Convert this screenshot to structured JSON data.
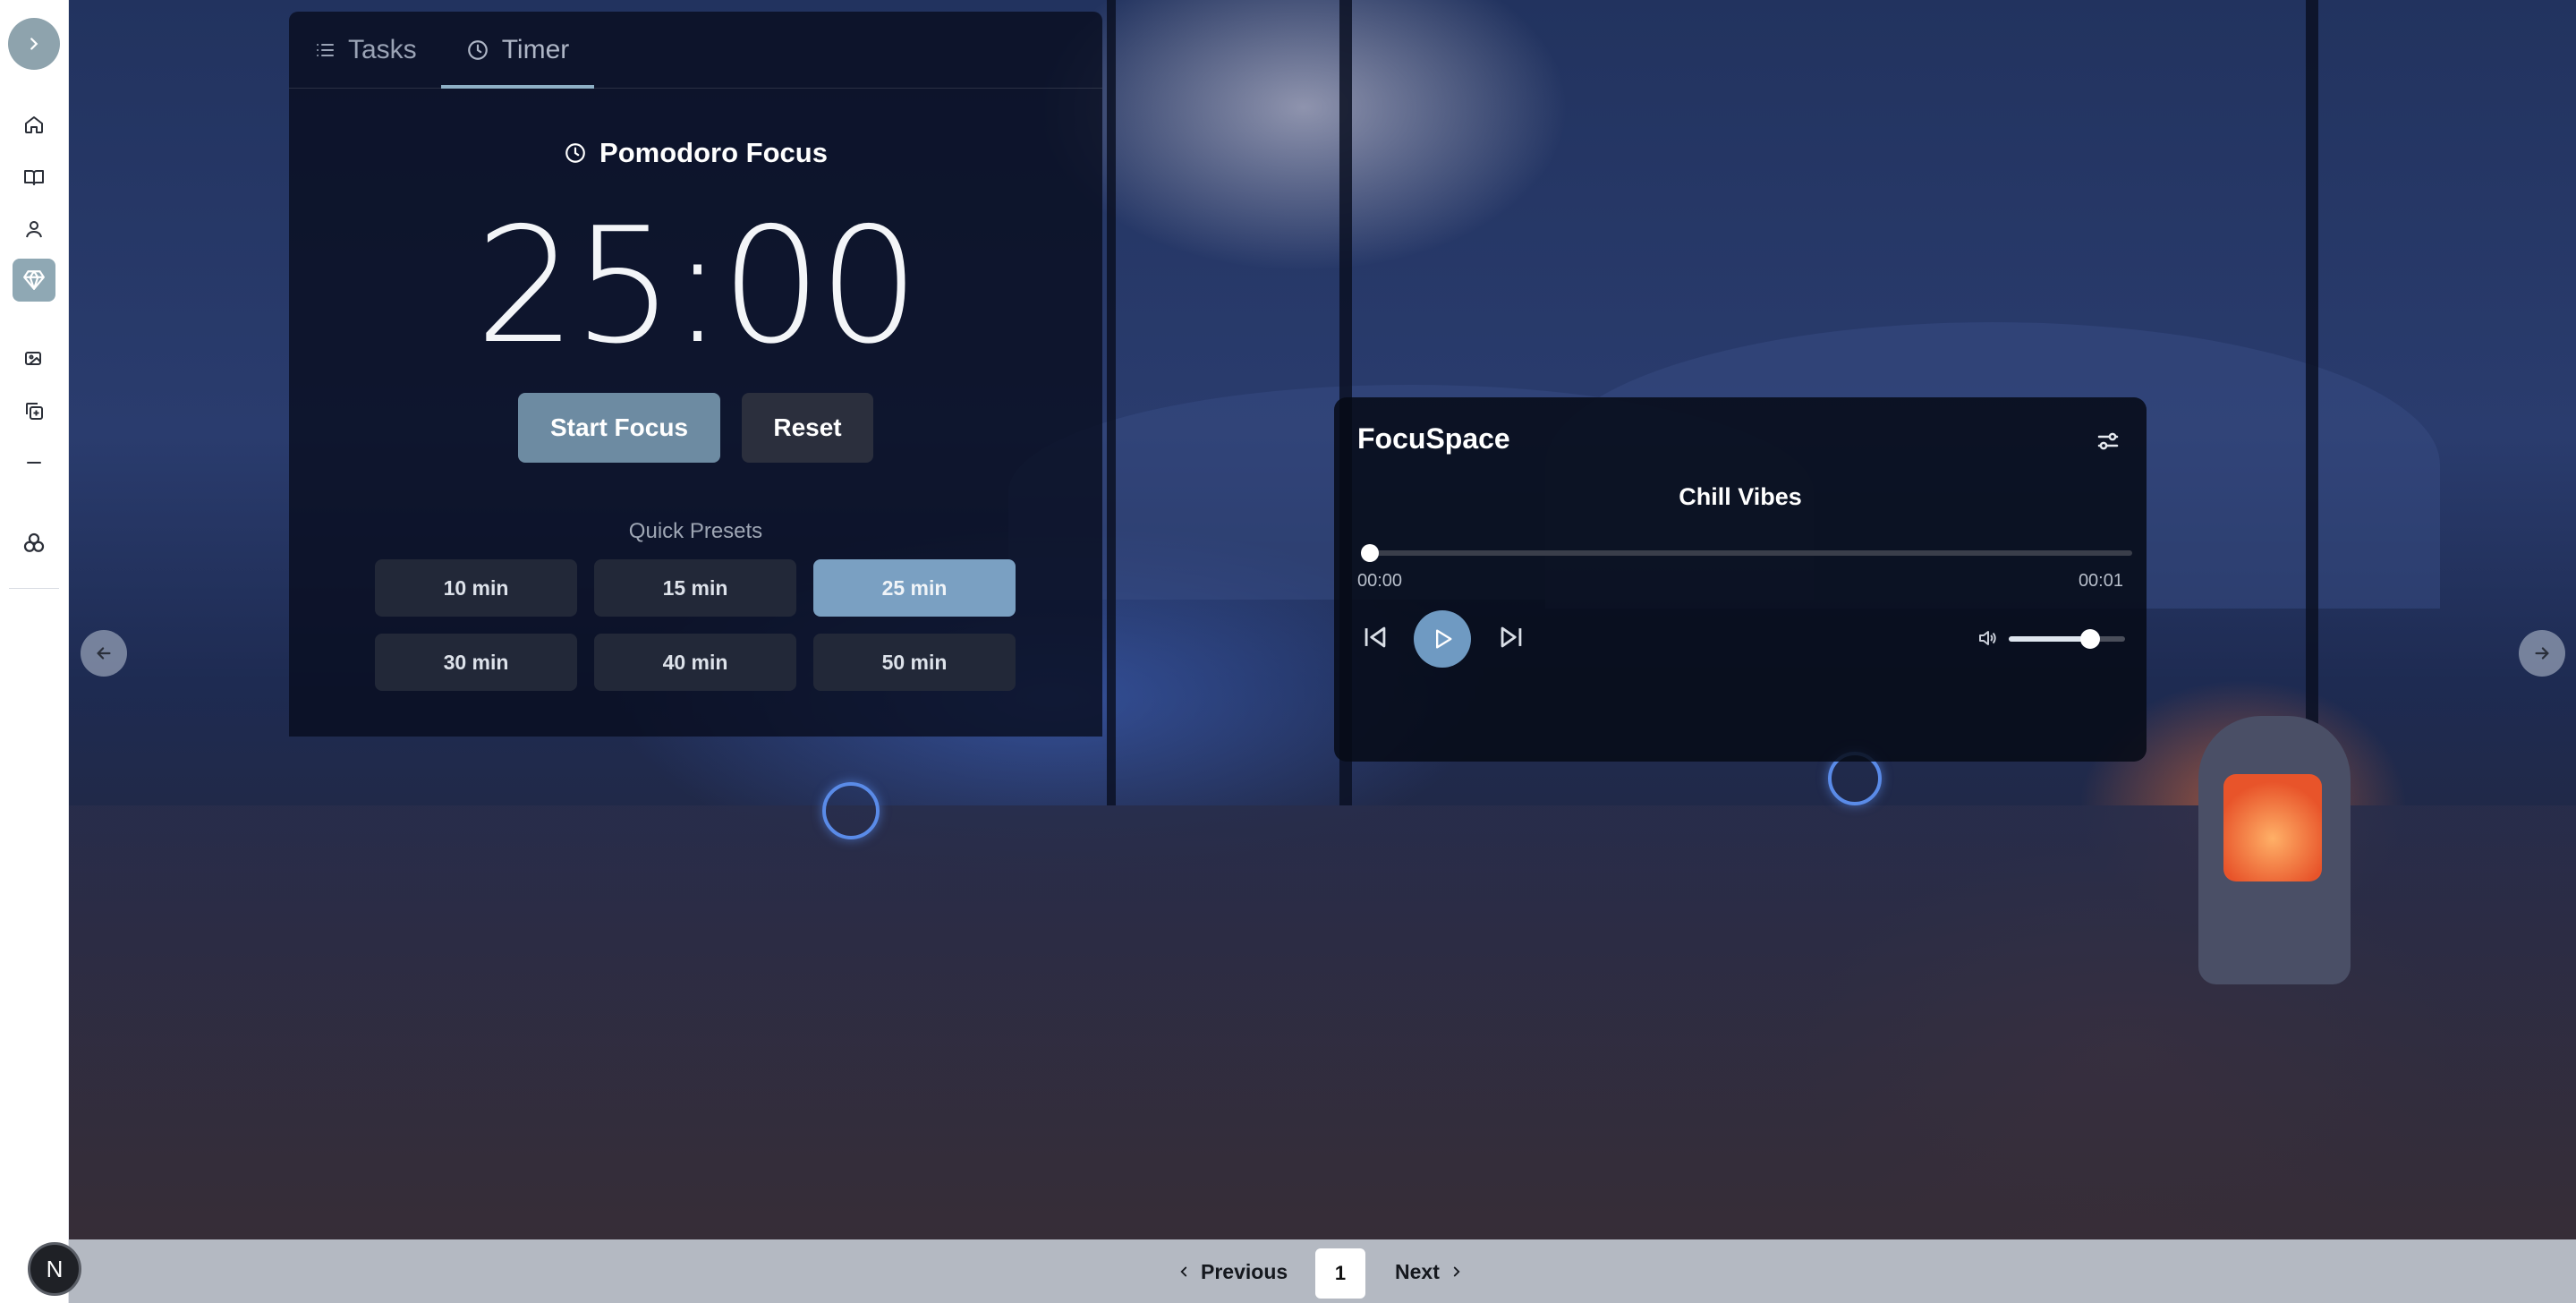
{
  "tabs": [
    {
      "label": "Tasks",
      "icon": "list-icon"
    },
    {
      "label": "Timer",
      "icon": "clock-icon"
    }
  ],
  "timer": {
    "title": "Pomodoro Focus",
    "display": "25:00",
    "start_label": "Start Focus",
    "reset_label": "Reset",
    "presets_label": "Quick Presets",
    "presets": [
      "10 min",
      "15 min",
      "25 min",
      "30 min",
      "40 min",
      "50 min"
    ],
    "active_preset": "25 min"
  },
  "player": {
    "title": "FocuSpace",
    "track": "Chill Vibes",
    "time_elapsed": "00:00",
    "time_total": "00:01",
    "progress": 0.0,
    "volume": 0.7
  },
  "sidebar": {
    "items": [
      "home-icon",
      "book-open-icon",
      "user-icon",
      "gem-icon",
      "image-icon",
      "copy-plus-icon",
      "minus-icon",
      "trefoil-icon"
    ],
    "active_item": "gem-icon",
    "avatar_initial": "N"
  },
  "pagination": {
    "prev_label": "Previous",
    "page": "1",
    "next_label": "Next"
  },
  "colors": {
    "accent": "#7aa0c2",
    "start_button": "#6d8ba2",
    "panel_bg": "#080e20"
  }
}
